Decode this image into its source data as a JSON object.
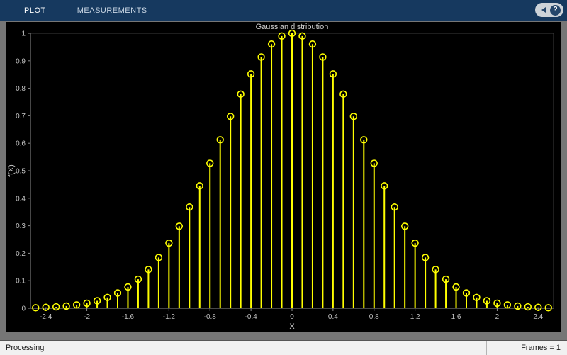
{
  "toolbar": {
    "tabs": [
      {
        "label": "PLOT"
      },
      {
        "label": "MEASUREMENTS"
      }
    ],
    "help_label": "?"
  },
  "statusbar": {
    "left": "Processing",
    "right": "Frames = 1"
  },
  "chart_data": {
    "type": "stem",
    "title": "Gaussian distribution",
    "xlabel": "X",
    "ylabel": "f(X)",
    "xlim": [
      -2.55,
      2.55
    ],
    "ylim": [
      0,
      1
    ],
    "grid": false,
    "background": "#000000",
    "stem_color": "#ffff00",
    "axis_color": "#8e8e8e",
    "tick_color": "#c2c2c2",
    "title_color": "#cdcdcd",
    "marker": "open-circle",
    "x_ticks": [
      -2.4,
      -2,
      -1.6,
      -1.2,
      -0.8,
      -0.4,
      0,
      0.4,
      0.8,
      1.2,
      1.6,
      2,
      2.4
    ],
    "x_tick_labels": [
      "-2.4",
      "-2",
      "-1.6",
      "-1.2",
      "-0.8",
      "-0.4",
      "0",
      "0.4",
      "0.8",
      "1.2",
      "1.6",
      "2",
      "2.4"
    ],
    "y_ticks": [
      0,
      0.1,
      0.2,
      0.3,
      0.4,
      0.5,
      0.6,
      0.7,
      0.8,
      0.9,
      1
    ],
    "y_tick_labels": [
      "0",
      "0.1",
      "0.2",
      "0.3",
      "0.4",
      "0.5",
      "0.6",
      "0.7",
      "0.8",
      "0.9",
      "1"
    ],
    "x": [
      -2.5,
      -2.4,
      -2.3,
      -2.2,
      -2.1,
      -2.0,
      -1.9,
      -1.8,
      -1.7,
      -1.6,
      -1.5,
      -1.4,
      -1.3,
      -1.2,
      -1.1,
      -1.0,
      -0.9,
      -0.8,
      -0.7,
      -0.6,
      -0.5,
      -0.4,
      -0.3,
      -0.2,
      -0.1,
      0,
      0.1,
      0.2,
      0.3,
      0.4,
      0.5,
      0.6,
      0.7,
      0.8,
      0.9,
      1.0,
      1.1,
      1.2,
      1.3,
      1.4,
      1.5,
      1.6,
      1.7,
      1.8,
      1.9,
      2.0,
      2.1,
      2.2,
      2.3,
      2.4,
      2.5
    ],
    "values": [
      0.0019,
      0.0032,
      0.0051,
      0.0079,
      0.0121,
      0.0183,
      0.0271,
      0.0392,
      0.0556,
      0.0773,
      0.1054,
      0.1409,
      0.1845,
      0.2369,
      0.2982,
      0.3679,
      0.4449,
      0.5273,
      0.6126,
      0.6977,
      0.7788,
      0.8521,
      0.9139,
      0.9608,
      0.99,
      1.0,
      0.99,
      0.9608,
      0.9139,
      0.8521,
      0.7788,
      0.6977,
      0.6126,
      0.5273,
      0.4449,
      0.3679,
      0.2982,
      0.2369,
      0.1845,
      0.1409,
      0.1054,
      0.0773,
      0.0556,
      0.0392,
      0.0271,
      0.0183,
      0.0121,
      0.0079,
      0.0051,
      0.0032,
      0.0019
    ]
  }
}
